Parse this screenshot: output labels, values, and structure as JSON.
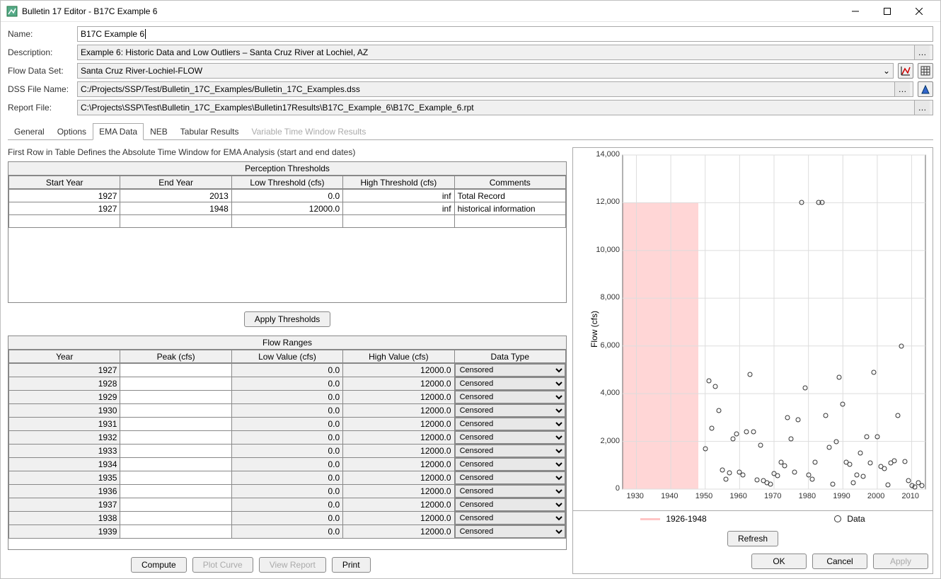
{
  "window_title": "Bulletin 17 Editor - B17C Example 6",
  "labels": {
    "name": "Name:",
    "description": "Description:",
    "flow_data_set": "Flow Data Set:",
    "dss_file_name": "DSS File Name:",
    "report_file": "Report File:"
  },
  "fields": {
    "name": "B17C Example 6",
    "description": "Example 6: Historic Data and Low Outliers – Santa Cruz River at Lochiel, AZ",
    "flow_data_set": "Santa Cruz River-Lochiel-FLOW",
    "dss_file": "C:/Projects/SSP/Test/Bulletin_17C_Examples/Bulletin_17C_Examples.dss",
    "report_file": "C:\\Projects\\SSP\\Test\\Bulletin_17C_Examples\\Bulletin17Results\\B17C_Example_6\\B17C_Example_6.rpt"
  },
  "tabs": [
    "General",
    "Options",
    "EMA Data",
    "NEB",
    "Tabular Results",
    "Variable Time Window Results"
  ],
  "hint": "First Row in Table Defines the Absolute Time Window for EMA Analysis (start and end dates)",
  "pthresh": {
    "title": "Perception Thresholds",
    "headers": [
      "Start Year",
      "End Year",
      "Low Threshold (cfs)",
      "High Threshold (cfs)",
      "Comments"
    ],
    "rows": [
      {
        "start": "1927",
        "end": "2013",
        "low": "0.0",
        "high": "inf",
        "comment": "Total Record",
        "cls": "row-green"
      },
      {
        "start": "1927",
        "end": "1948",
        "low": "12000.0",
        "high": "inf",
        "comment": "historical information",
        "cls": "row-pink"
      }
    ]
  },
  "apply_thresholds": "Apply Thresholds",
  "flow_ranges": {
    "title": "Flow Ranges",
    "headers": [
      "Year",
      "Peak (cfs)",
      "Low Value (cfs)",
      "High Value (cfs)",
      "Data Type"
    ],
    "rows": [
      {
        "year": "1927",
        "peak": "",
        "low": "0.0",
        "high": "12000.0",
        "type": "Censored"
      },
      {
        "year": "1928",
        "peak": "",
        "low": "0.0",
        "high": "12000.0",
        "type": "Censored"
      },
      {
        "year": "1929",
        "peak": "",
        "low": "0.0",
        "high": "12000.0",
        "type": "Censored"
      },
      {
        "year": "1930",
        "peak": "",
        "low": "0.0",
        "high": "12000.0",
        "type": "Censored"
      },
      {
        "year": "1931",
        "peak": "",
        "low": "0.0",
        "high": "12000.0",
        "type": "Censored"
      },
      {
        "year": "1932",
        "peak": "",
        "low": "0.0",
        "high": "12000.0",
        "type": "Censored"
      },
      {
        "year": "1933",
        "peak": "",
        "low": "0.0",
        "high": "12000.0",
        "type": "Censored"
      },
      {
        "year": "1934",
        "peak": "",
        "low": "0.0",
        "high": "12000.0",
        "type": "Censored"
      },
      {
        "year": "1935",
        "peak": "",
        "low": "0.0",
        "high": "12000.0",
        "type": "Censored"
      },
      {
        "year": "1936",
        "peak": "",
        "low": "0.0",
        "high": "12000.0",
        "type": "Censored"
      },
      {
        "year": "1937",
        "peak": "",
        "low": "0.0",
        "high": "12000.0",
        "type": "Censored"
      },
      {
        "year": "1938",
        "peak": "",
        "low": "0.0",
        "high": "12000.0",
        "type": "Censored"
      },
      {
        "year": "1939",
        "peak": "",
        "low": "0.0",
        "high": "12000.0",
        "type": "Censored"
      }
    ]
  },
  "chart_data": {
    "type": "scatter",
    "xlabel": "",
    "ylabel": "Flow (cfs)",
    "x_ticks": [
      1930,
      1940,
      1950,
      1960,
      1970,
      1980,
      1990,
      2000,
      2010
    ],
    "y_ticks": [
      0,
      2000,
      4000,
      6000,
      8000,
      10000,
      12000,
      14000
    ],
    "xlim": [
      1926,
      2014
    ],
    "ylim": [
      0,
      14000
    ],
    "pink_band": {
      "xmin": 1926,
      "xmax": 1948,
      "ymin": 0,
      "ymax": 12000
    },
    "series": [
      {
        "name": "Data",
        "points": [
          [
            1950,
            1700
          ],
          [
            1951,
            4550
          ],
          [
            1952,
            2550
          ],
          [
            1953,
            4300
          ],
          [
            1954,
            3300
          ],
          [
            1955,
            800
          ],
          [
            1956,
            430
          ],
          [
            1957,
            680
          ],
          [
            1958,
            2100
          ],
          [
            1959,
            2300
          ],
          [
            1960,
            700
          ],
          [
            1961,
            600
          ],
          [
            1962,
            2400
          ],
          [
            1963,
            4800
          ],
          [
            1964,
            2400
          ],
          [
            1965,
            400
          ],
          [
            1966,
            1850
          ],
          [
            1967,
            350
          ],
          [
            1968,
            280
          ],
          [
            1969,
            200
          ],
          [
            1970,
            650
          ],
          [
            1971,
            550
          ],
          [
            1972,
            1120
          ],
          [
            1973,
            980
          ],
          [
            1974,
            3000
          ],
          [
            1975,
            2100
          ],
          [
            1976,
            700
          ],
          [
            1977,
            2900
          ],
          [
            1978,
            12000
          ],
          [
            1979,
            4250
          ],
          [
            1980,
            580
          ],
          [
            1981,
            420
          ],
          [
            1982,
            1140
          ],
          [
            1983,
            12000
          ],
          [
            1984,
            12000
          ],
          [
            1985,
            3100
          ],
          [
            1986,
            1760
          ],
          [
            1987,
            210
          ],
          [
            1988,
            2000
          ],
          [
            1989,
            4700
          ],
          [
            1990,
            3550
          ],
          [
            1991,
            1140
          ],
          [
            1992,
            1050
          ],
          [
            1993,
            260
          ],
          [
            1994,
            600
          ],
          [
            1995,
            1500
          ],
          [
            1996,
            520
          ],
          [
            1997,
            2200
          ],
          [
            1998,
            1100
          ],
          [
            1999,
            4900
          ],
          [
            2000,
            2200
          ],
          [
            2001,
            940
          ],
          [
            2002,
            870
          ],
          [
            2003,
            170
          ],
          [
            2004,
            1100
          ],
          [
            2005,
            1200
          ],
          [
            2006,
            3080
          ],
          [
            2007,
            6000
          ],
          [
            2008,
            1160
          ],
          [
            2009,
            360
          ],
          [
            2010,
            150
          ],
          [
            2011,
            100
          ],
          [
            2012,
            260
          ],
          [
            2013,
            160
          ]
        ]
      }
    ],
    "legend": [
      {
        "swatch": "pink",
        "label": "1926-1948"
      },
      {
        "swatch": "data",
        "label": "Data"
      }
    ]
  },
  "buttons": {
    "compute": "Compute",
    "plot_curve": "Plot Curve",
    "view_report": "View Report",
    "print": "Print",
    "refresh": "Refresh",
    "ok": "OK",
    "cancel": "Cancel",
    "apply": "Apply"
  }
}
